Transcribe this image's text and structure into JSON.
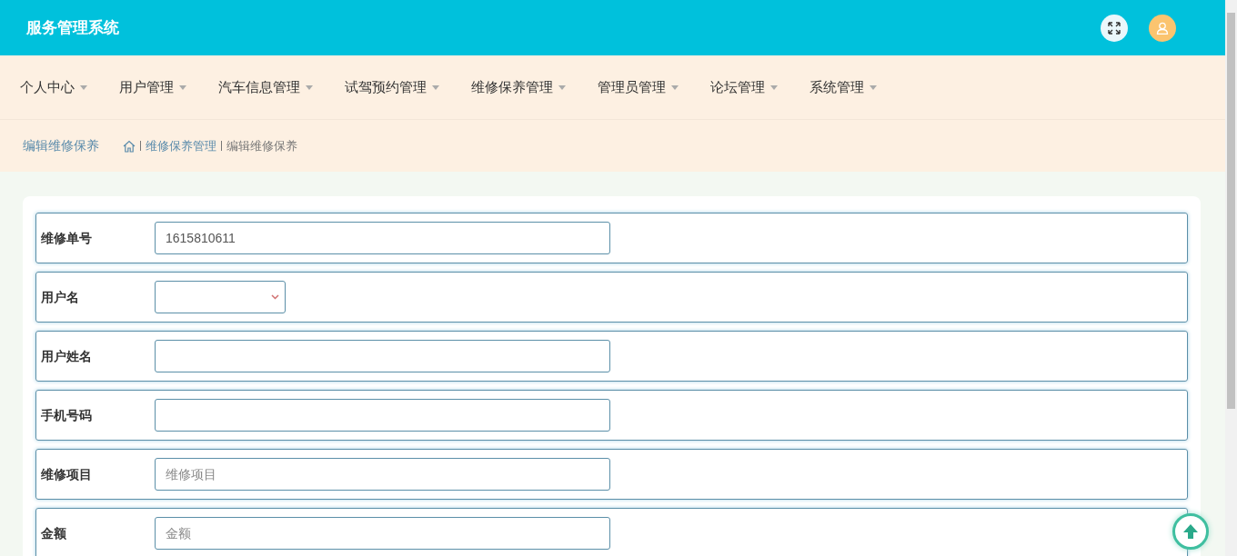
{
  "header": {
    "title": "服务管理系统"
  },
  "nav": [
    {
      "label": "个人中心"
    },
    {
      "label": "用户管理"
    },
    {
      "label": "汽车信息管理"
    },
    {
      "label": "试驾预约管理"
    },
    {
      "label": "维修保养管理"
    },
    {
      "label": "管理员管理"
    },
    {
      "label": "论坛管理"
    },
    {
      "label": "系统管理"
    }
  ],
  "breadcrumb": {
    "page_title": "编辑维修保养",
    "items": [
      "维修保养管理",
      "编辑维修保养"
    ]
  },
  "form": [
    {
      "label": "维修单号",
      "kind": "text",
      "value": "1615810611"
    },
    {
      "label": "用户名",
      "kind": "select"
    },
    {
      "label": "用户姓名",
      "kind": "text"
    },
    {
      "label": "手机号码",
      "kind": "text"
    },
    {
      "label": "维修项目",
      "kind": "text",
      "placeholder": "维修项目"
    },
    {
      "label": "金额",
      "kind": "text",
      "placeholder": "金额"
    }
  ]
}
